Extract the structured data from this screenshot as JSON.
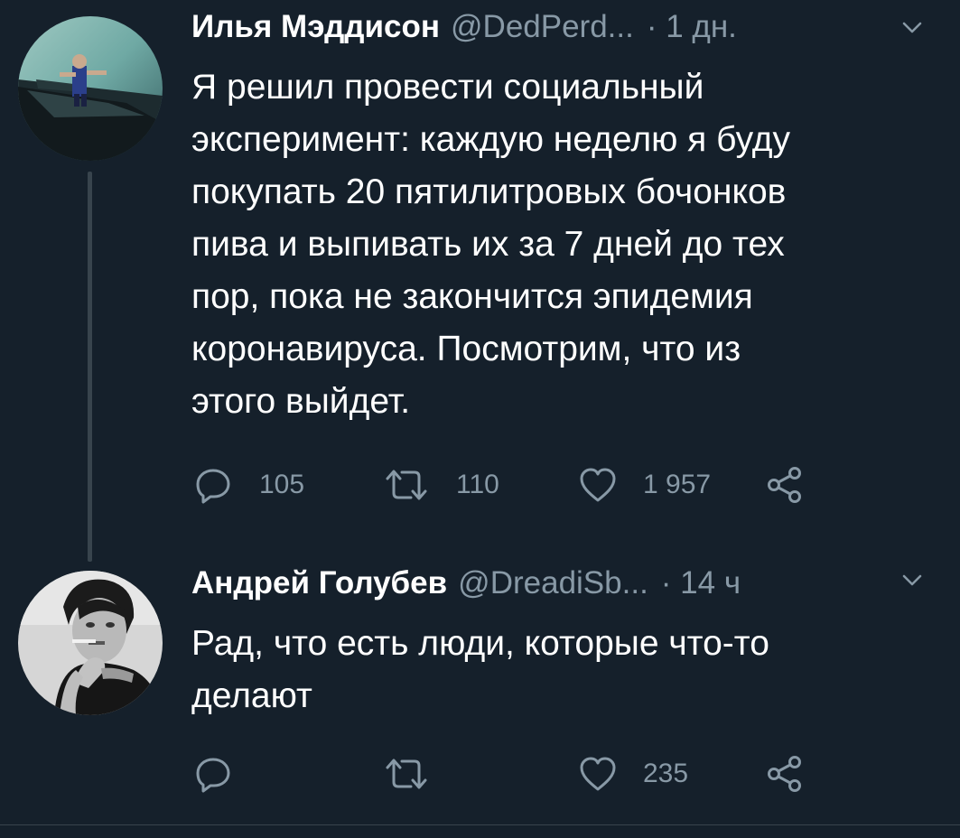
{
  "theme": {
    "background": "#15202b",
    "text_primary": "#ffffff",
    "text_secondary": "#8899a6",
    "line": "#38444d"
  },
  "tweets": [
    {
      "author_name": "Илья Мэддисон",
      "handle": "@DedPerd...",
      "time": "· 1 дн.",
      "text_lines": [
        "Я решил провести социальный",
        "эксперимент: каждую неделю я буду",
        "покупать 20 пятилитровых бочонков",
        "пива и выпивать их за 7 дней до тех",
        "пор, пока не закончится эпидемия",
        "коронавируса. Посмотрим, что из",
        "этого выйдет."
      ],
      "replies": "105",
      "retweets": "110",
      "likes": "1 957",
      "avatar_icon": "avatar-figure-on-rooftop"
    },
    {
      "author_name": "Андрей Голубев",
      "handle": "@DreadiSb...",
      "time": "· 14 ч",
      "text_lines": [
        "Рад, что есть люди, которые что-то",
        "делают"
      ],
      "replies": "",
      "retweets": "",
      "likes": "235",
      "avatar_icon": "avatar-man-smoking"
    }
  ],
  "icons": {
    "reply": "reply-icon",
    "retweet": "retweet-icon",
    "like": "heart-icon",
    "share": "share-icon",
    "caret": "chevron-down-icon"
  }
}
